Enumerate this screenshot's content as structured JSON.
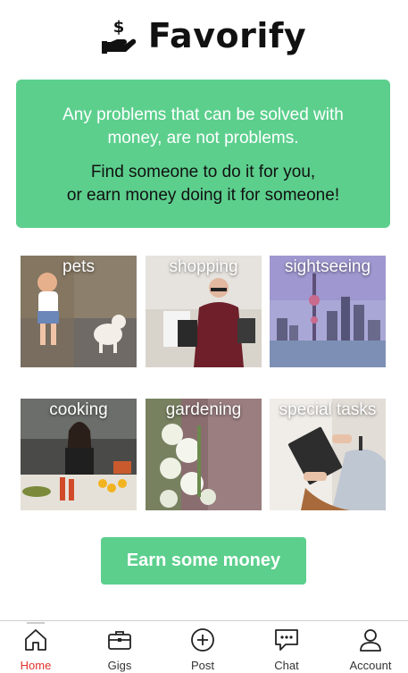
{
  "app": {
    "title": "Favorify",
    "logo_icon": "hand-dollar-icon"
  },
  "banner": {
    "quote": "Any problems that can be solved with money, are not problems.",
    "cta": "Find someone to do it for you,\nor earn money doing it for someone!",
    "background_color": "#5ccf8d"
  },
  "categories": [
    {
      "label": "pets"
    },
    {
      "label": "shopping"
    },
    {
      "label": "sightseeing"
    },
    {
      "label": "cooking"
    },
    {
      "label": "gardening"
    },
    {
      "label": "special tasks"
    }
  ],
  "earn_button": {
    "label": "Earn some money"
  },
  "bottom_nav": {
    "active_color": "#e0342b",
    "items": [
      {
        "label": "Home",
        "icon": "home-icon",
        "active": true
      },
      {
        "label": "Gigs",
        "icon": "briefcase-icon",
        "active": false
      },
      {
        "label": "Post",
        "icon": "plus-circle-icon",
        "active": false
      },
      {
        "label": "Chat",
        "icon": "chat-bubble-icon",
        "active": false
      },
      {
        "label": "Account",
        "icon": "user-icon",
        "active": false
      }
    ]
  }
}
